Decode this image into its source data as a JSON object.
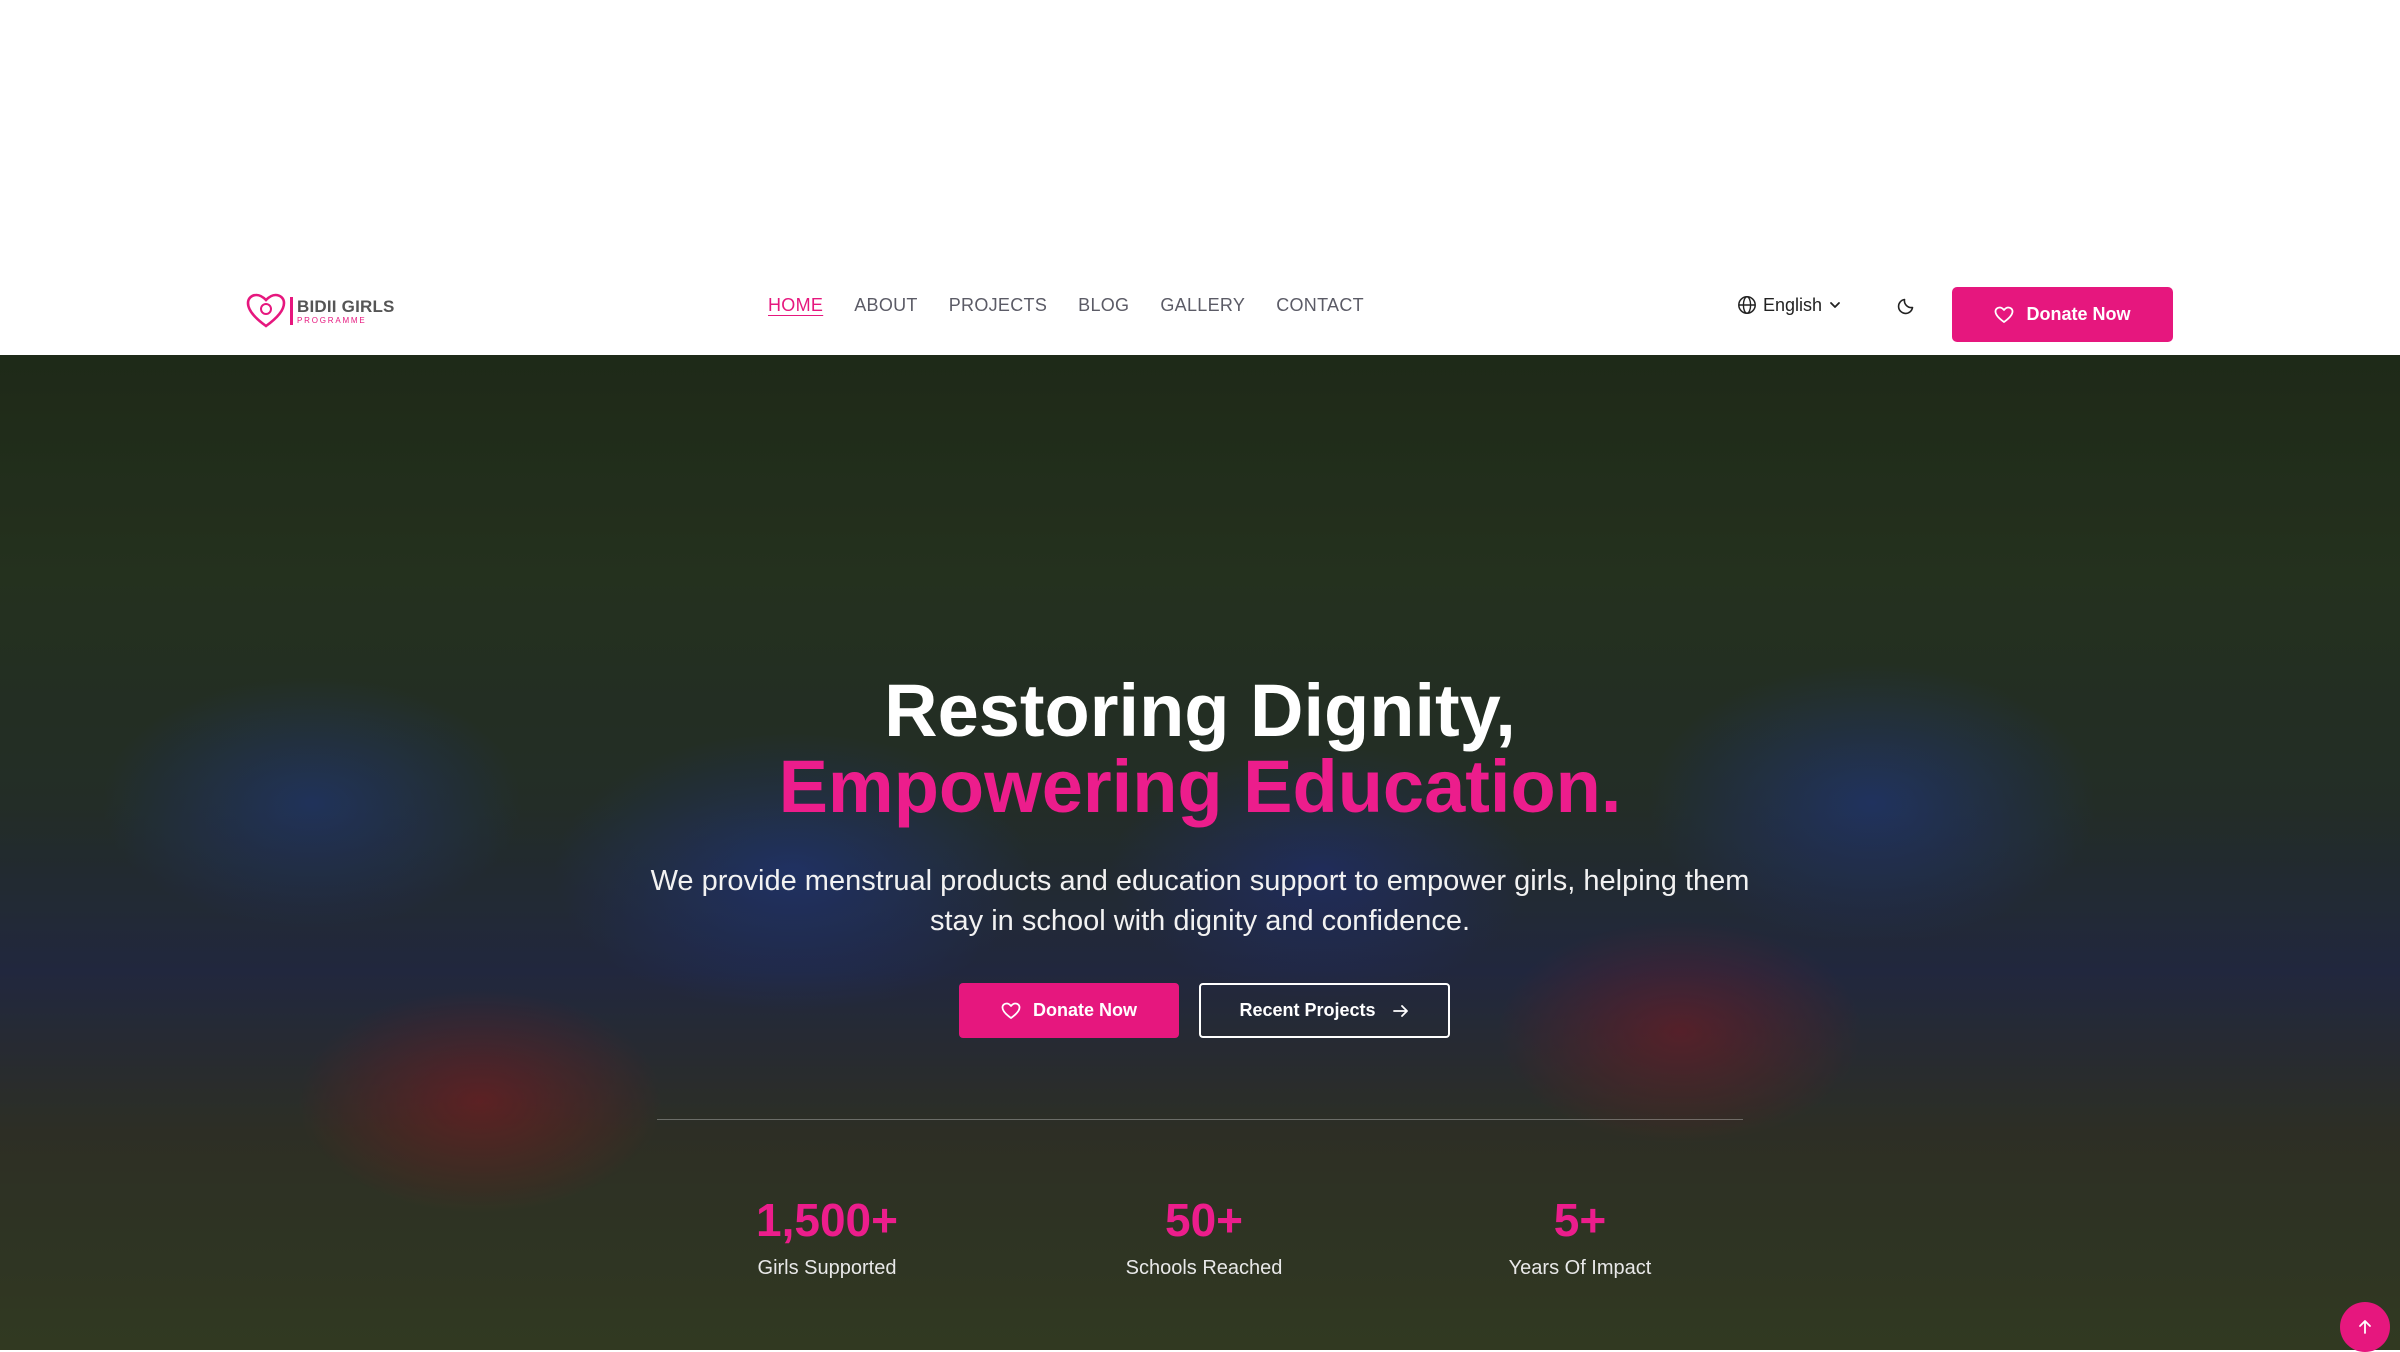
{
  "brand": {
    "name": "BIDII GIRLS",
    "tagline": "PROGRAMME",
    "accent_color": "#e6177e"
  },
  "nav": {
    "links": [
      "HOME",
      "ABOUT",
      "PROJECTS",
      "BLOG",
      "GALLERY",
      "CONTACT"
    ],
    "active": "HOME",
    "language": "English",
    "donate_label": "Donate Now"
  },
  "hero": {
    "title_line1": "Restoring Dignity,",
    "title_line2": "Empowering Education.",
    "description": "We provide menstrual products and education support to empower girls, helping them stay in school with dignity and confidence.",
    "donate_label": "Donate Now",
    "projects_label": "Recent Projects"
  },
  "stats": [
    {
      "value": "1,500+",
      "label": "Girls Supported"
    },
    {
      "value": "50+",
      "label": "Schools Reached"
    },
    {
      "value": "5+",
      "label": "Years Of Impact"
    }
  ],
  "icons": {
    "language": "globe-icon",
    "language_toggle": "chevron-down-icon",
    "theme": "moon-icon",
    "donate": "heart-icon",
    "projects": "arrow-right-icon",
    "scroll_top": "arrow-up-icon"
  }
}
